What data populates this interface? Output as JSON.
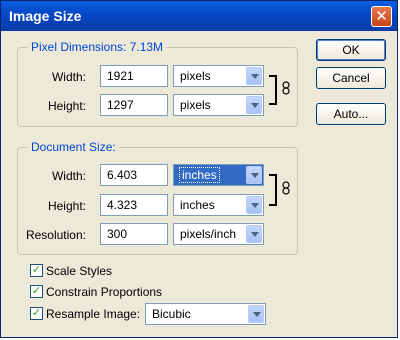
{
  "window": {
    "title": "Image Size"
  },
  "pixel_dimensions": {
    "legend": "Pixel Dimensions:  7.13M",
    "width_label": "Width:",
    "width_value": "1921",
    "width_unit": "pixels",
    "height_label": "Height:",
    "height_value": "1297",
    "height_unit": "pixels"
  },
  "document_size": {
    "legend": "Document Size:",
    "width_label": "Width:",
    "width_value": "6.403",
    "width_unit": "inches",
    "height_label": "Height:",
    "height_value": "4.323",
    "height_unit": "inches",
    "resolution_label": "Resolution:",
    "resolution_value": "300",
    "resolution_unit": "pixels/inch"
  },
  "buttons": {
    "ok": "OK",
    "cancel": "Cancel",
    "auto": "Auto..."
  },
  "options": {
    "scale_styles": "Scale Styles",
    "constrain_proportions": "Constrain Proportions",
    "resample_image": "Resample Image:",
    "resample_method": "Bicubic",
    "checked": true
  },
  "colors": {
    "legend": "#0046d5",
    "titlebar": "#0648c8",
    "selection": "#316ac5",
    "check": "#21a121"
  }
}
